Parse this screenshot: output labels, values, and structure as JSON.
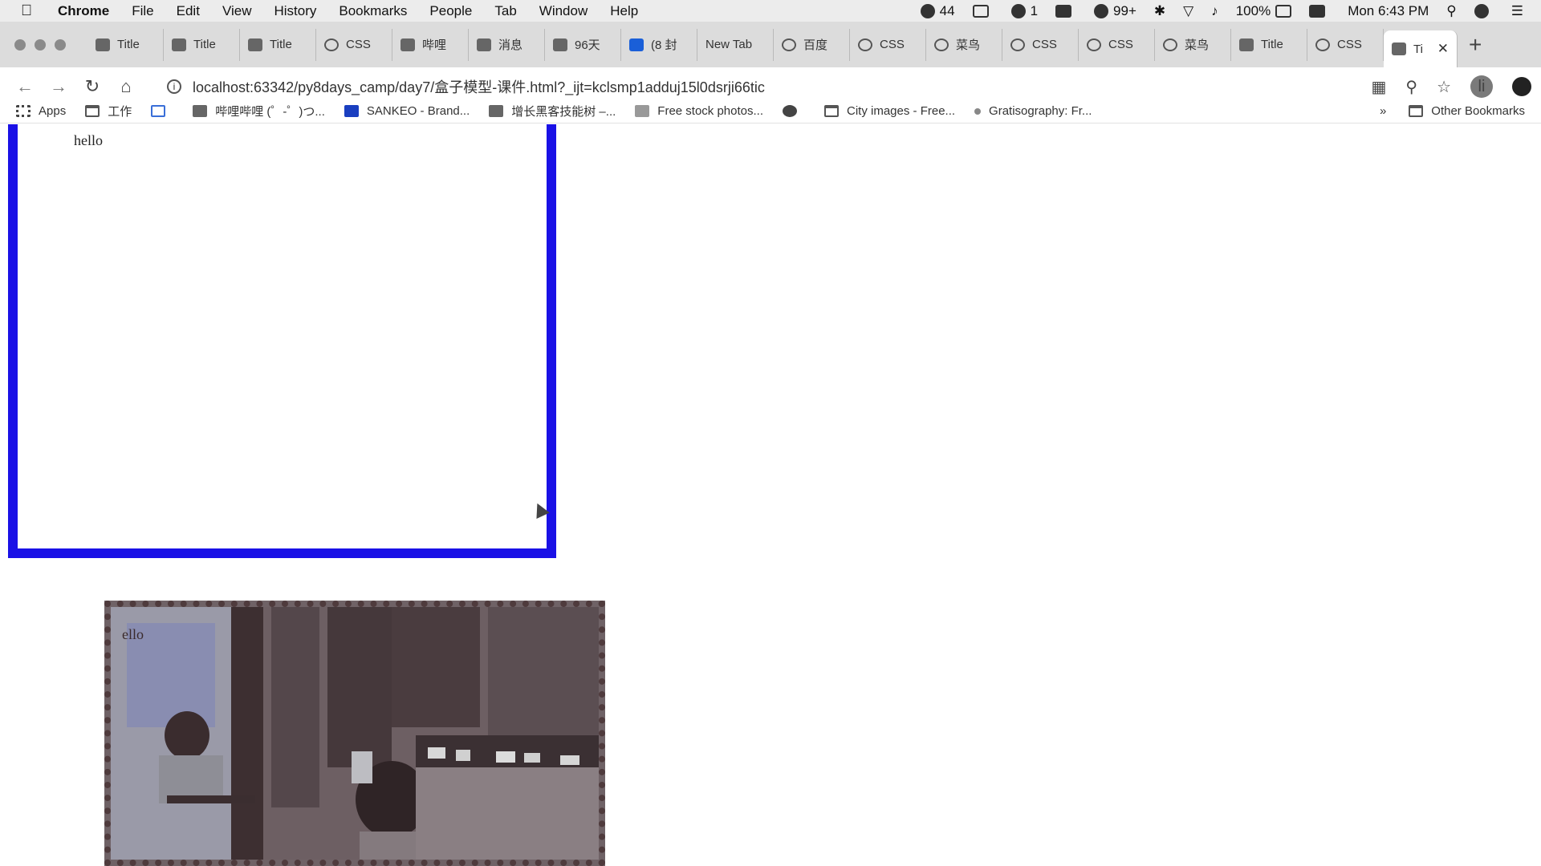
{
  "menubar": {
    "app": "Chrome",
    "items": [
      "File",
      "Edit",
      "View",
      "History",
      "Bookmarks",
      "People",
      "Tab",
      "Window",
      "Help"
    ],
    "status": {
      "wechat": "44",
      "media": "1",
      "qq": "99+",
      "battery": "100%",
      "clock": "Mon 6:43 PM"
    }
  },
  "tabs": [
    {
      "label": "Title"
    },
    {
      "label": "Title"
    },
    {
      "label": "Title"
    },
    {
      "label": "CSS"
    },
    {
      "label": "哔哩"
    },
    {
      "label": "消息"
    },
    {
      "label": "96天"
    },
    {
      "label": "(8 封"
    },
    {
      "label": "New Tab"
    },
    {
      "label": "百度"
    },
    {
      "label": "CSS"
    },
    {
      "label": "菜鸟"
    },
    {
      "label": "CSS"
    },
    {
      "label": "CSS"
    },
    {
      "label": "菜鸟"
    },
    {
      "label": "Title"
    },
    {
      "label": "CSS"
    },
    {
      "label": "Ti",
      "active": true
    }
  ],
  "toolbar": {
    "url": "localhost:63342/py8days_camp/day7/盒子模型-课件.html?_ijt=kclsmp1adduj15l0dsrji66tic",
    "avatar_letter": "li"
  },
  "bookmarks": {
    "items": [
      {
        "label": "Apps"
      },
      {
        "label": "工作"
      },
      {
        "label": "哔哩哔哩 (゜-゜)つ..."
      },
      {
        "label": "SANKEO - Brand..."
      },
      {
        "label": "增长黑客技能树 –..."
      },
      {
        "label": "Free stock photos..."
      },
      {
        "label": "City images - Free..."
      },
      {
        "label": "Gratisography: Fr..."
      }
    ],
    "more": "»",
    "other": "Other Bookmarks"
  },
  "page": {
    "box1_text": "hello",
    "box2_text": "ello",
    "colors": {
      "border_blue": "#1a11e6",
      "dotted_border": "#4f3b3d"
    }
  }
}
